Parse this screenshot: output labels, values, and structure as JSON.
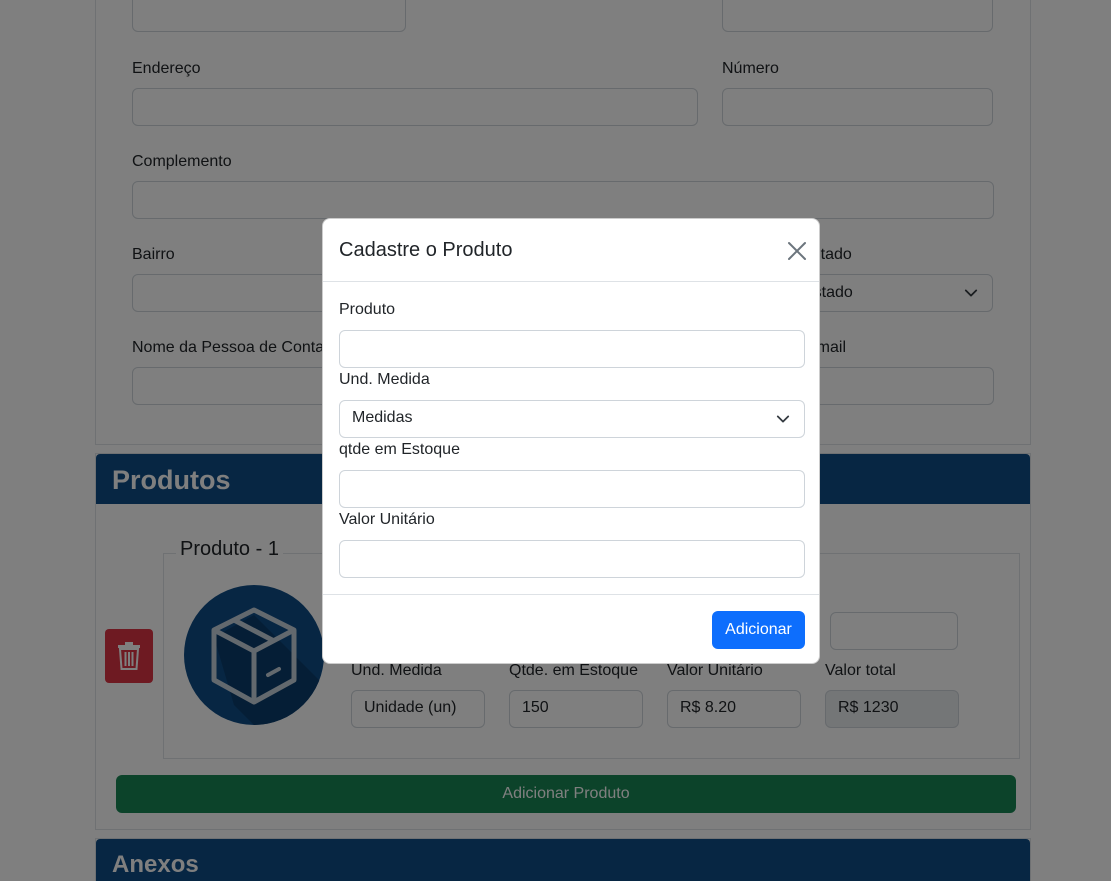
{
  "form": {
    "endereco_label": "Endereço",
    "numero_label": "Número",
    "complemento_label": "Complemento",
    "bairro_label": "Bairro",
    "estado_label": "Estado",
    "estado_placeholder": "Estado",
    "contato_label": "Nome da Pessoa de Contato",
    "email_label": "Email"
  },
  "products": {
    "header": "Produtos",
    "legend": "Produto - 1",
    "fields": {
      "und_label": "Und. Medida",
      "und_value": "Unidade (un)",
      "qtde_label": "Qtde. em Estoque",
      "qtde_value": "150",
      "valor_unit_label": "Valor Unitário",
      "valor_unit_value": "R$ 8.20",
      "valor_total_label": "Valor total",
      "valor_total_value": "R$ 1230"
    },
    "add_button": "Adicionar Produto"
  },
  "anexos": {
    "header": "Anexos"
  },
  "modal": {
    "title": "Cadastre o Produto",
    "produto_label": "Produto",
    "und_label": "Und. Medida",
    "und_selected": "Medidas",
    "qtde_label": "qtde em Estoque",
    "valor_label": "Valor Unitário",
    "submit": "Adicionar"
  },
  "colors": {
    "primary": "#0d6efd",
    "header_blue": "#0f4d87",
    "success": "#198754",
    "danger": "#dc3545"
  }
}
